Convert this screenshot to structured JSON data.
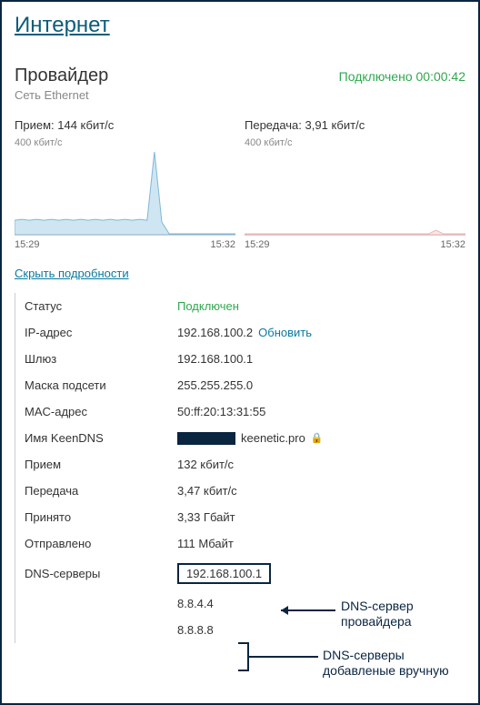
{
  "page_title": "Интернет",
  "provider": {
    "title": "Провайдер",
    "network_type": "Сеть Ethernet",
    "status_text": "Подключено",
    "uptime": "00:00:42"
  },
  "rx": {
    "label": "Прием:",
    "rate": "144 кбит/с",
    "scale": "400 кбит/с",
    "time_start": "15:29",
    "time_end": "15:32"
  },
  "tx": {
    "label": "Передача:",
    "rate": "3,91 кбит/с",
    "scale": "400 кбит/с",
    "time_start": "15:29",
    "time_end": "15:32"
  },
  "toggle_details": "Скрыть подробности",
  "details": {
    "status_label": "Статус",
    "status_value": "Подключен",
    "ip_label": "IP-адрес",
    "ip_value": "192.168.100.2",
    "ip_refresh": "Обновить",
    "gateway_label": "Шлюз",
    "gateway_value": "192.168.100.1",
    "mask_label": "Маска подсети",
    "mask_value": "255.255.255.0",
    "mac_label": "MAC-адрес",
    "mac_value": "50:ff:20:13:31:55",
    "keendns_label": "Имя KeenDNS",
    "keendns_suffix": "keenetic.pro",
    "rx_label": "Прием",
    "rx_value": "132 кбит/с",
    "tx_label": "Передача",
    "tx_value": "3,47 кбит/с",
    "received_label": "Принято",
    "received_value": "3,33 Гбайт",
    "sent_label": "Отправлено",
    "sent_value": "111 Мбайт",
    "dns_label": "DNS-серверы",
    "dns_primary": "192.168.100.1",
    "dns_manual_1": "8.8.4.4",
    "dns_manual_2": "8.8.8.8"
  },
  "annotations": {
    "provider_dns": "DNS-сервер провайдера",
    "manual_dns": "DNS-серверы добавленые вручную"
  },
  "chart_data": [
    {
      "type": "area",
      "title": "Прием",
      "ylabel": "кбит/с",
      "ylim": [
        0,
        400
      ],
      "x_range": [
        "15:29",
        "15:32"
      ],
      "values": [
        70,
        72,
        68,
        75,
        70,
        73,
        69,
        71,
        68,
        74,
        70,
        72,
        69,
        75,
        71,
        68,
        70,
        73,
        69,
        395,
        60,
        5,
        3,
        2,
        3,
        2,
        3,
        2,
        3,
        2
      ]
    },
    {
      "type": "area",
      "title": "Передача",
      "ylabel": "кбит/с",
      "ylim": [
        0,
        400
      ],
      "x_range": [
        "15:29",
        "15:32"
      ],
      "values": [
        3,
        3,
        3,
        3,
        3,
        3,
        3,
        3,
        3,
        3,
        3,
        3,
        3,
        3,
        3,
        3,
        3,
        3,
        3,
        3,
        3,
        3,
        3,
        3,
        3,
        3,
        20,
        3,
        3,
        3
      ]
    }
  ]
}
